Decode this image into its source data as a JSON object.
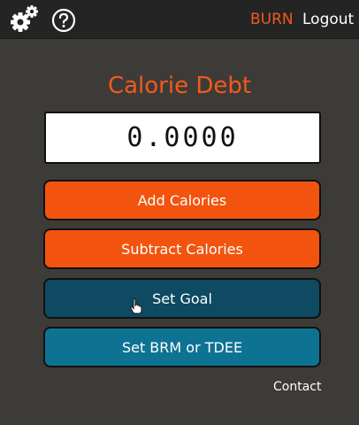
{
  "header": {
    "settings_icon": "gears-icon",
    "help_icon": "help-icon",
    "burn_label": "BURN",
    "logout_label": "Logout"
  },
  "main": {
    "title": "Calorie Debt",
    "display_value": "0.0000",
    "buttons": {
      "add": "Add Calories",
      "subtract": "Subtract Calories",
      "goal": "Set Goal",
      "bmr": "Set BRM or TDEE"
    },
    "contact_label": "Contact"
  },
  "colors": {
    "accent_orange": "#f25a1c",
    "button_orange": "#f2540f",
    "goal_button": "#0e4a62",
    "bmr_button": "#0e7393",
    "background": "#3d3b38",
    "topbar": "#242424"
  }
}
